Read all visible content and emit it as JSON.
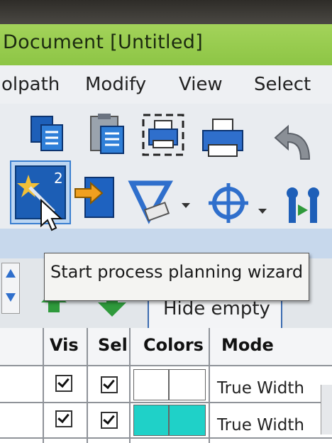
{
  "window": {
    "title": "Document [Untitled]"
  },
  "menu": {
    "items": [
      "olpath",
      "Modify",
      "View",
      "Select"
    ]
  },
  "toolbar": {
    "row1": [
      "copy-icon",
      "paste-icon",
      "print-preview-icon",
      "print-icon",
      "undo-icon"
    ],
    "row2": [
      "process-planning-wizard-icon",
      "import-icon",
      "measure-icon",
      "target-icon",
      "toolpath-icon"
    ],
    "wizard_badge": "2"
  },
  "tooltip": {
    "text": "Start process planning wizard"
  },
  "panel": {
    "hide_empty_label": "Hide empty"
  },
  "table": {
    "headers": [
      "Vis",
      "Sel",
      "Colors",
      "Mode"
    ],
    "rows": [
      {
        "vis": true,
        "sel": true,
        "colors": [
          "#ffffff",
          "#ffffff"
        ],
        "mode": "True Width"
      },
      {
        "vis": true,
        "sel": true,
        "colors": [
          "#1fd1c8",
          "#1fd1c8"
        ],
        "mode": "True Width"
      }
    ]
  },
  "colors": {
    "titlebar": "#9ccc50",
    "accent": "#3a7fd0",
    "arrow_green": "#2f9a3c"
  }
}
